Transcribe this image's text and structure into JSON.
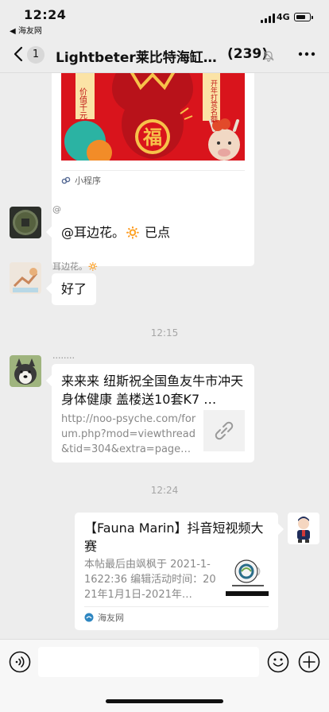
{
  "status_bar": {
    "time": "12:24",
    "back_app": "◀ 海友网",
    "network": "4G"
  },
  "nav": {
    "unread_badge": "1",
    "title": "Lightbeter莱比特海缸灯…",
    "member_count": "(239)"
  },
  "messages": {
    "mini_program_card": {
      "footer_label": "小程序",
      "art_char": "福",
      "side_text": "价值千元",
      "side_text2": "开年打赏名额"
    },
    "msg1": {
      "sender": "@",
      "text": "@耳边花。🔅 已点"
    },
    "msg2": {
      "sender": "耳边花。🔅",
      "text": "好了"
    },
    "timestamp1": "12:15",
    "msg3": {
      "sender": "........",
      "title": "来来来 纽斯祝全国鱼友牛市冲天 身体健康 盖楼送10套K7 …",
      "description": "http://noo-psyche.com/forum.php?mod=viewthread&tid=304&extra=page…"
    },
    "timestamp2": "12:24",
    "msg4": {
      "title": "【Fauna Marin】抖音短视频大赛",
      "description": "本帖最后由飒枫于 2021-1-1622:36 编辑活动时间：2021年1月1日-2021年…",
      "source": "海友网"
    }
  },
  "input_bar": {
    "placeholder": ""
  },
  "colors": {
    "background": "#ededed",
    "bubble": "#ffffff",
    "timestamp": "#a6a6a6",
    "mini_program": "#576b95"
  }
}
